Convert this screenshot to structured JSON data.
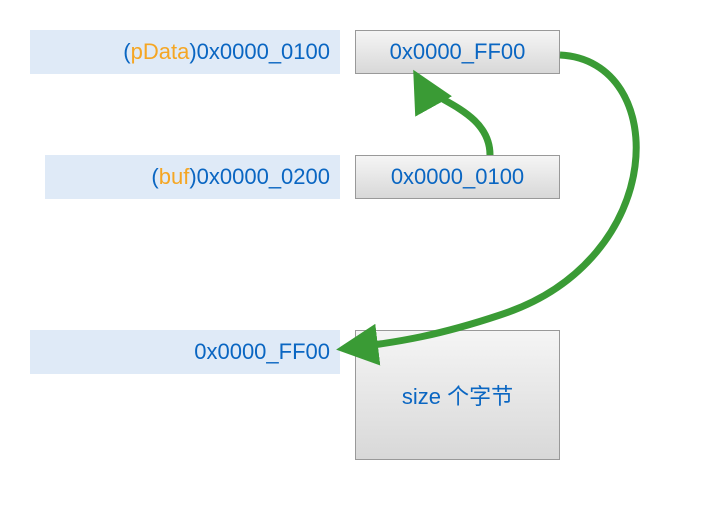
{
  "row1": {
    "var": "pData",
    "lparen": "(",
    "rparen": ") ",
    "addr": "0x0000_0100",
    "value": "0x0000_FF00"
  },
  "row2": {
    "var": "buf",
    "lparen": "(",
    "rparen": ") ",
    "addr": "0x0000_0200",
    "value": "0x0000_0100"
  },
  "row3": {
    "addr": "0x0000_FF00",
    "value": "size 个字节"
  },
  "colors": {
    "arrow": "#3a9b35"
  }
}
